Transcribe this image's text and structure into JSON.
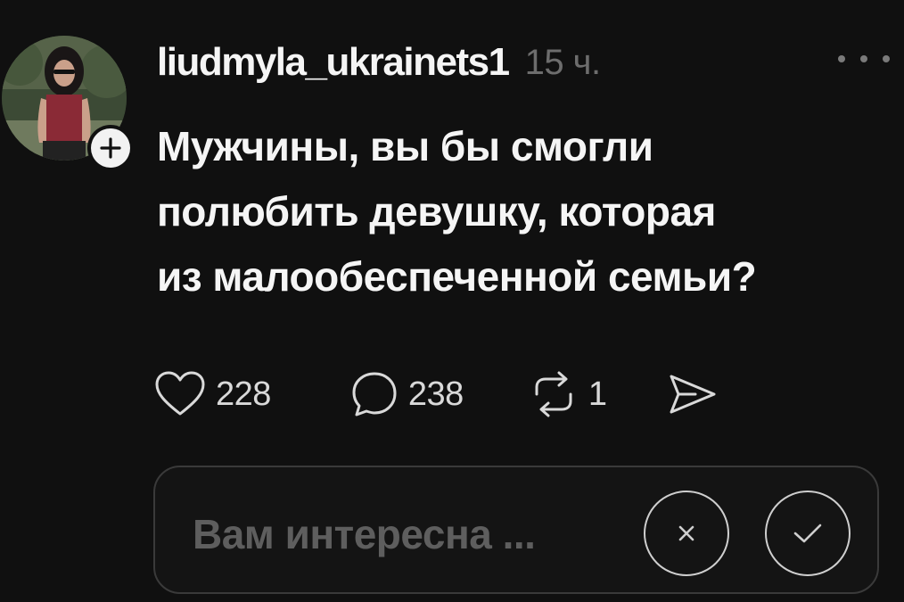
{
  "post": {
    "username": "liudmyla_ukrainets1",
    "timestamp": "15 ч.",
    "text_lines": [
      "Мужчины, вы бы смогли",
      "полюбить девушку, которая",
      "из малообеспеченной семьи?"
    ]
  },
  "actions": {
    "likes": "228",
    "replies": "238",
    "reposts": "1"
  },
  "survey": {
    "prompt": "Вам интересна ..."
  },
  "icons": {
    "follow": "plus-icon",
    "more": "ellipsis-icon",
    "like": "heart-icon",
    "reply": "speech-bubble-icon",
    "repost": "repost-icon",
    "share": "send-icon",
    "dismiss": "close-icon",
    "confirm": "check-icon"
  },
  "colors": {
    "background": "#101010",
    "text": "#f5f5f5",
    "muted": "#6d6d6d"
  }
}
